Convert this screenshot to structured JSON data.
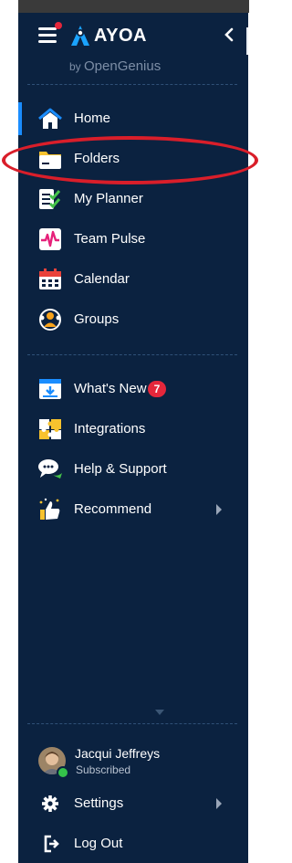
{
  "brand": {
    "name": "AYOA",
    "byline_prefix": "by ",
    "byline_company": "OpenGenius"
  },
  "nav_primary": [
    {
      "label": "Home",
      "icon": "home-icon"
    },
    {
      "label": "Folders",
      "icon": "folder-icon"
    },
    {
      "label": "My Planner",
      "icon": "planner-icon"
    },
    {
      "label": "Team Pulse",
      "icon": "pulse-icon"
    },
    {
      "label": "Calendar",
      "icon": "calendar-icon"
    },
    {
      "label": "Groups",
      "icon": "groups-icon"
    }
  ],
  "nav_secondary": [
    {
      "label": "What's New",
      "icon": "news-icon",
      "badge": "7"
    },
    {
      "label": "Integrations",
      "icon": "puzzle-icon"
    },
    {
      "label": "Help & Support",
      "icon": "chat-icon"
    },
    {
      "label": "Recommend",
      "icon": "thumbs-up-icon"
    }
  ],
  "user": {
    "name": "Jacqui Jeffreys",
    "status": "Subscribed"
  },
  "footer": [
    {
      "label": "Settings",
      "icon": "gear-icon"
    },
    {
      "label": "Log Out",
      "icon": "logout-icon"
    }
  ],
  "colors": {
    "sidebar_bg": "#0b2240",
    "accent": "#1a8dff",
    "badge": "#e5273b",
    "highlight_ring": "#d91e2a"
  }
}
